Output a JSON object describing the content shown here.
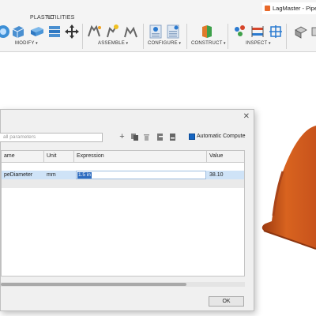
{
  "toolbar": {
    "tabs": [
      {
        "label": "PLASTIC"
      },
      {
        "label": "UTILITIES"
      }
    ],
    "groups": [
      {
        "label": "MODIFY"
      },
      {
        "label": "ASSEMBLE"
      },
      {
        "label": "CONFIGURE"
      },
      {
        "label": "CONSTRUCT"
      },
      {
        "label": "INSPECT"
      }
    ],
    "document_title": "LagMaster - Pipe Ins"
  },
  "dialog": {
    "filter_placeholder": "all parameters",
    "auto_compute_label": "Automatic Compute",
    "auto_compute_checked": true,
    "columns": [
      {
        "label": "ame"
      },
      {
        "label": "Unit"
      },
      {
        "label": "Expression"
      },
      {
        "label": "Value"
      }
    ],
    "rows": [
      {
        "name": "peDiameter",
        "unit": "mm",
        "expression": "1.5 in",
        "value": "38.10"
      }
    ],
    "ok_label": "OK"
  },
  "colors": {
    "accent": "#1664c0",
    "selection_row": "#cfe3f7",
    "model_orange": "#c8531c"
  }
}
